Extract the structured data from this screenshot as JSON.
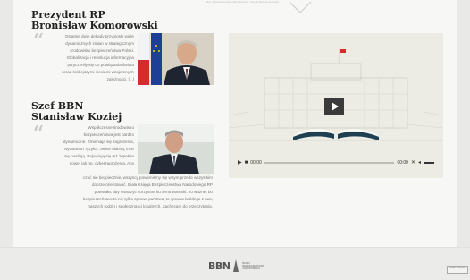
{
  "header": {
    "top_strip_text": "Biuro Bezpieczeństwa Narodowego · Księga Bezpieczeństwa"
  },
  "persons": [
    {
      "name": "Prezydent RP",
      "surname": "Bronisław Komorowski",
      "bio_lines": [
        "Ostatnie dwie dekady przyniosły wiele",
        "dynamicznych zmian w strategicznym",
        "środowisku bezpieczeństwa Polski.",
        "Globalizacja i rewolucja informacyjna",
        "przyczyniły się do powiązania świata",
        "coraz ściślejszymi sieciami wzajemnych",
        "zależności. [...]"
      ]
    },
    {
      "name": "Szef BBN",
      "surname": "Stanisław Koziej",
      "bio_lines_short": [
        "Współczesne środowisko",
        "bezpieczeństwa jest bardzo",
        "dynamiczne. Zmieniają się zagrożenia,",
        "wyzwania i ryzyka. Jedne słabną, inne",
        "się nasilają. Pojawiają się też zupełnie",
        "nowe, jak np. cyberzagrożenia. Aby",
        "czuć się bezpiecznie, wszyscy powinniśmy się w tym przede wszystkim"
      ],
      "bio_lines_long": [
        "dobrze orientować. Biała Księga Bezpieczeństwa Narodowego RP",
        "powstała, aby stworzyć korzystne ku temu warunki. To ważne, bo",
        "bezpieczeństwo to nie tylko sprawa państwa, to sprawa każdego z nas,",
        "naszych rodzin i społeczności lokalnych. Zachęcam do przeczytania."
      ]
    }
  ],
  "video": {
    "time_current": "00:00",
    "time_total": "00:00",
    "progress": 0,
    "icons": [
      "play-icon",
      "stop-icon",
      "fullscreen-icon",
      "volume-icon"
    ]
  },
  "footer": {
    "logo_letters": "BBN",
    "logo_sub_lines": [
      "BIURO",
      "BEZPIECZEŃSTWA",
      "NARODOWEGO"
    ],
    "badge_text": "BIAŁA KSIĘGA"
  },
  "colors": {
    "background": "#e9e9e7",
    "page": "#f7f7f5",
    "video_bg": "#ecece4",
    "flag_red": "#d42b2b",
    "eu_blue": "#1f3f96"
  }
}
